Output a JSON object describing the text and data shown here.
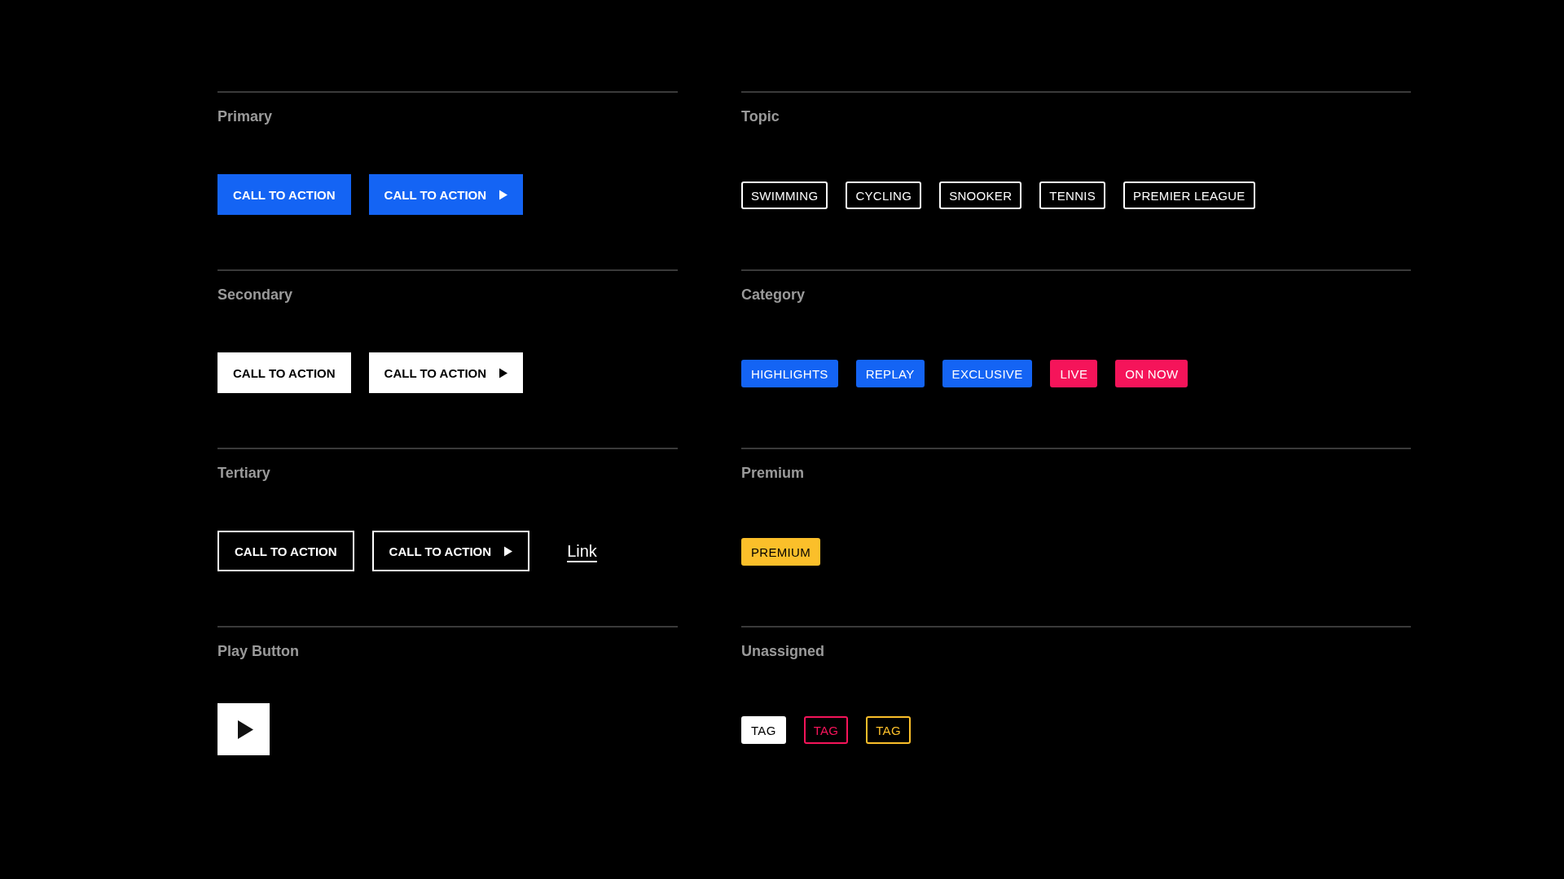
{
  "button_sections": [
    {
      "title": "Primary",
      "items": [
        {
          "kind": "primary",
          "label": "CALL TO ACTION",
          "arrow": false
        },
        {
          "kind": "primary",
          "label": "CALL TO ACTION",
          "arrow": true
        }
      ]
    },
    {
      "title": "Secondary",
      "items": [
        {
          "kind": "secondary",
          "label": "CALL TO ACTION",
          "arrow": false
        },
        {
          "kind": "secondary",
          "label": "CALL TO ACTION",
          "arrow": true
        }
      ]
    },
    {
      "title": "Tertiary",
      "items": [
        {
          "kind": "tertiary",
          "label": "CALL TO ACTION",
          "arrow": false
        },
        {
          "kind": "tertiary",
          "label": "CALL TO ACTION",
          "arrow": true
        },
        {
          "kind": "link",
          "label": "Link"
        }
      ]
    },
    {
      "title": "Play Button",
      "items": [
        {
          "kind": "play"
        }
      ]
    }
  ],
  "tag_sections": [
    {
      "title": "Topic",
      "tags": [
        {
          "label": "SWIMMING",
          "kind": "outline",
          "color": "#ffffff"
        },
        {
          "label": "CYCLING",
          "kind": "outline",
          "color": "#ffffff"
        },
        {
          "label": "SNOOKER",
          "kind": "outline",
          "color": "#ffffff"
        },
        {
          "label": "TENNIS",
          "kind": "outline",
          "color": "#ffffff"
        },
        {
          "label": "PREMIER LEAGUE",
          "kind": "outline",
          "color": "#ffffff"
        }
      ]
    },
    {
      "title": "Category",
      "tags": [
        {
          "label": "HIGHLIGHTS",
          "kind": "filled",
          "color": "#1464f4"
        },
        {
          "label": "REPLAY",
          "kind": "filled",
          "color": "#1464f4"
        },
        {
          "label": "EXCLUSIVE",
          "kind": "filled",
          "color": "#1464f4"
        },
        {
          "label": "LIVE",
          "kind": "filled",
          "color": "#f5145a"
        },
        {
          "label": "ON NOW",
          "kind": "filled",
          "color": "#f5145a"
        }
      ]
    },
    {
      "title": "Premium",
      "tags": [
        {
          "label": "PREMIUM",
          "kind": "filled",
          "color": "#fbbf2a"
        }
      ]
    },
    {
      "title": "Unassigned",
      "tags": [
        {
          "label": "TAG",
          "kind": "filled",
          "color": "#ffffff"
        },
        {
          "label": "TAG",
          "kind": "outline",
          "color": "#f5145a"
        },
        {
          "label": "TAG",
          "kind": "outline",
          "color": "#fbbf2a"
        }
      ]
    }
  ]
}
